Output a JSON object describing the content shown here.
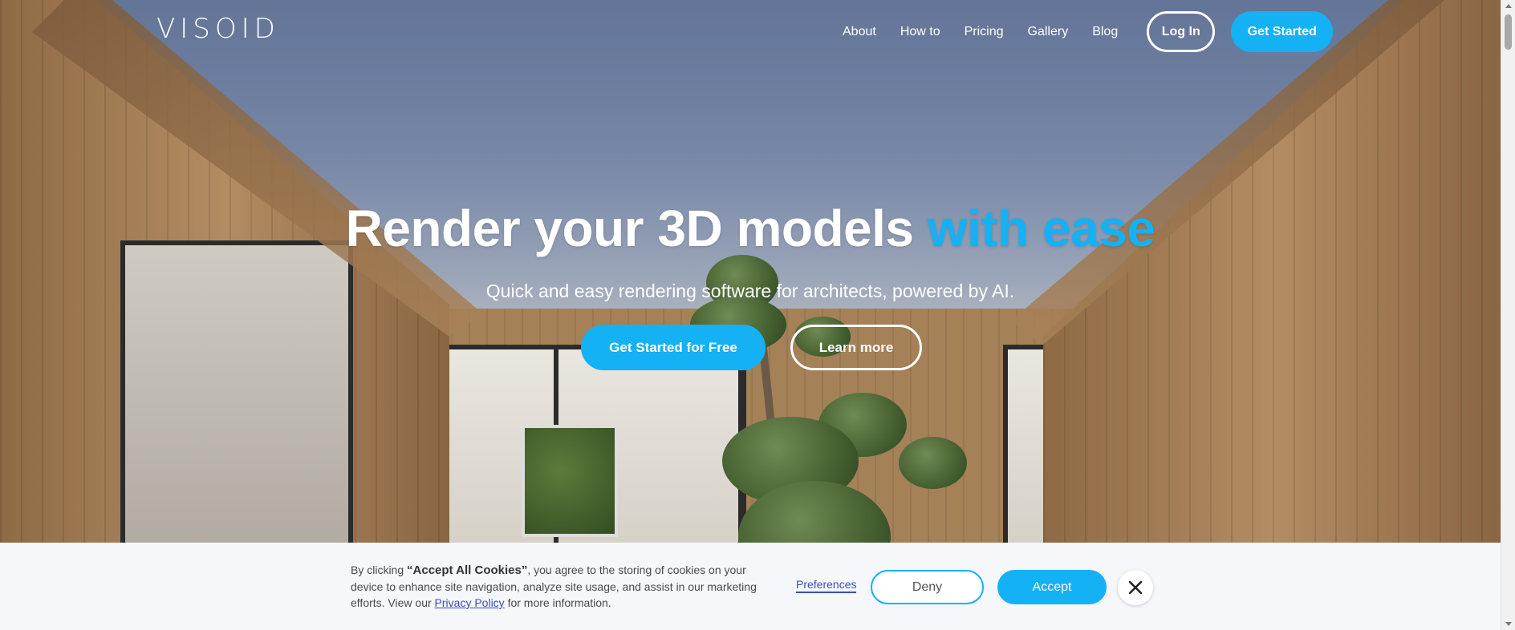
{
  "brand": {
    "logo": "VISOID"
  },
  "nav": {
    "links": [
      "About",
      "How to",
      "Pricing",
      "Gallery",
      "Blog"
    ],
    "login_label": "Log In",
    "get_started_label": "Get Started"
  },
  "hero": {
    "headline_main": "Render your 3D models ",
    "headline_accent": "with ease",
    "subheadline": "Quick and easy rendering software for architects, powered by AI.",
    "primary_cta": "Get Started for Free",
    "secondary_cta": "Learn more"
  },
  "cookie_banner": {
    "text_prefix": "By clicking ",
    "text_bold": "“Accept All Cookies”",
    "text_middle": ", you agree to the storing of cookies on your device to enhance site navigation, analyze site usage, and assist in our marketing efforts. View our ",
    "policy_link": "Privacy Policy",
    "text_suffix": " for more information.",
    "preferences_label": "Preferences",
    "deny_label": "Deny",
    "accept_label": "Accept",
    "close_icon": "close-icon"
  },
  "colors": {
    "accent": "#14b1f5",
    "link": "#3a4fb8",
    "banner_bg": "#f5f7fb"
  }
}
